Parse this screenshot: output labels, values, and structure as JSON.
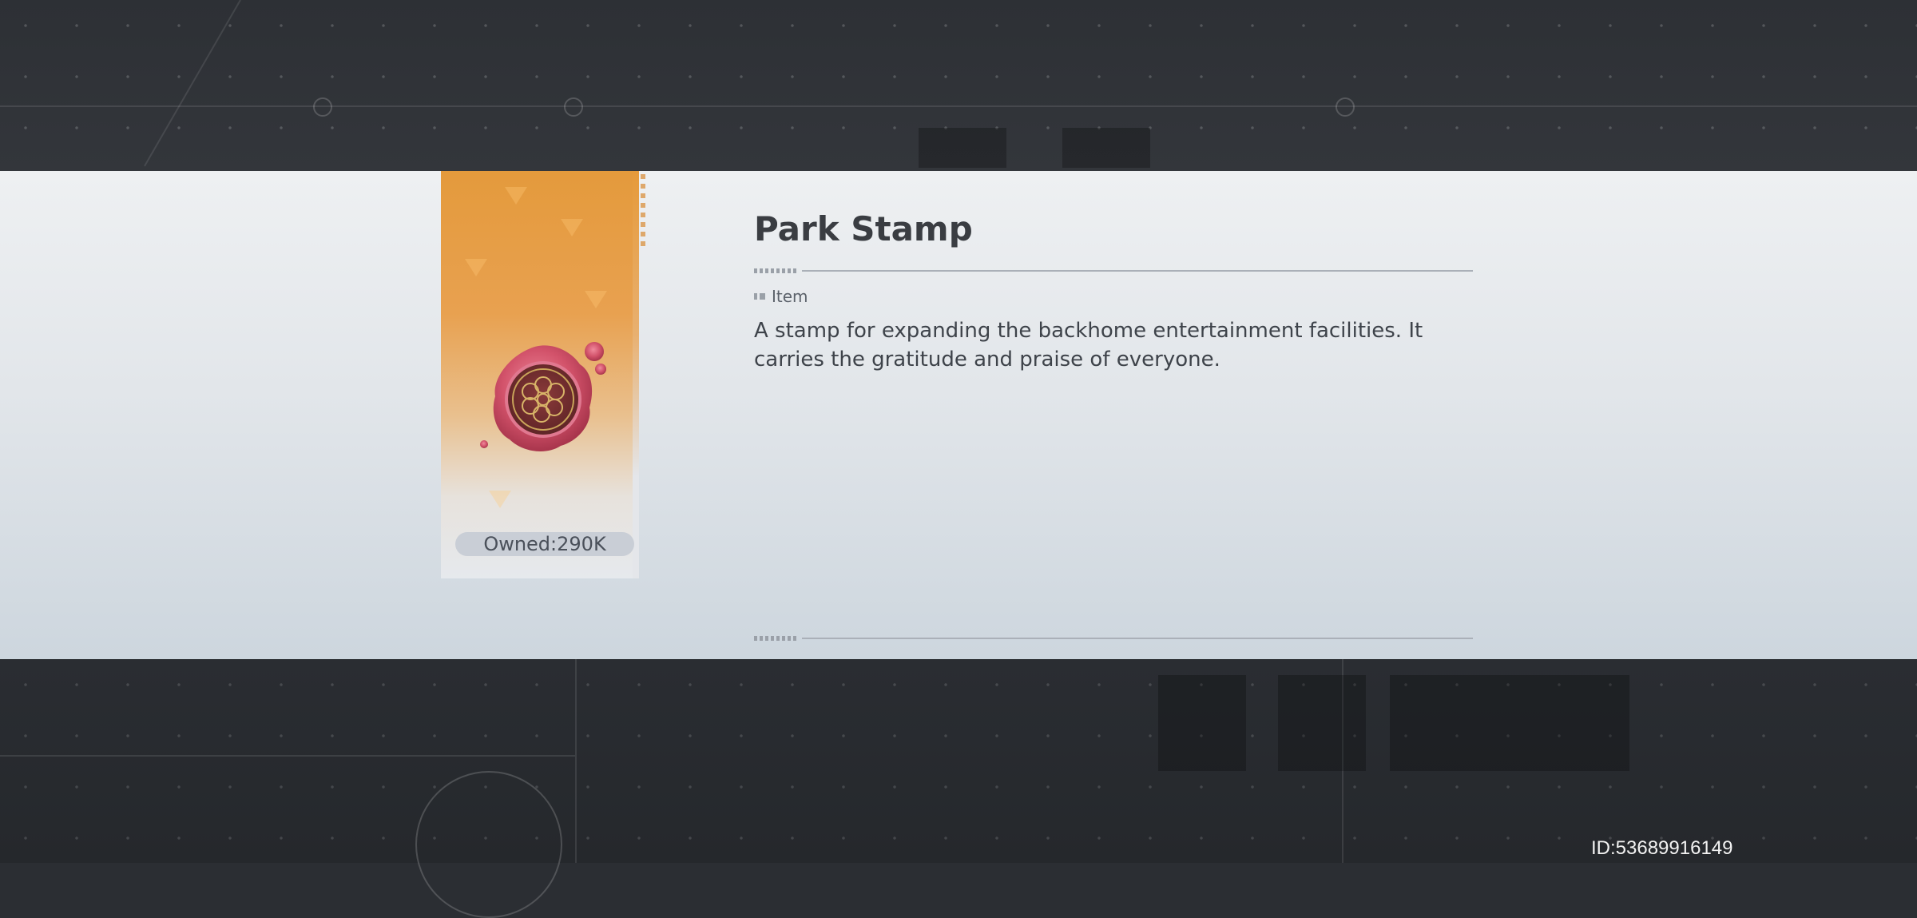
{
  "item": {
    "name": "Park Stamp",
    "type": "Item",
    "description": "A stamp for expanding the backhome entertainment facilities. It carries the gratitude and praise of everyone.",
    "owned_label": "Owned:290K",
    "icon": "wax-seal-stamp-icon"
  },
  "footer": {
    "uid": "ID:53689916149"
  },
  "colors": {
    "card_accent": "#e49a3c",
    "seal": "#d2526a",
    "panel": "#e8ebee"
  }
}
